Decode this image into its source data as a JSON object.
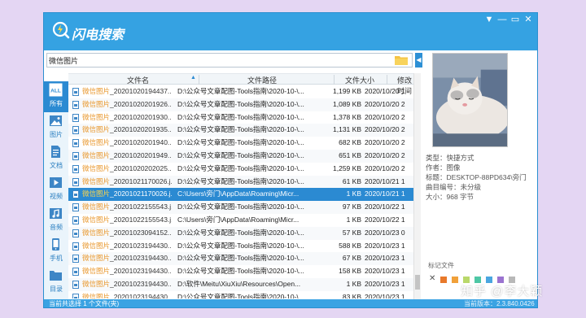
{
  "app": {
    "title": "闪电搜索",
    "window_buttons": [
      "▼",
      "—",
      "▭",
      "✕"
    ]
  },
  "search": {
    "value": "微信图片",
    "placeholder": ""
  },
  "sidebar": {
    "items": [
      {
        "label": "所有",
        "icon": "all-icon",
        "active": true
      },
      {
        "label": "图片",
        "icon": "image-icon"
      },
      {
        "label": "文档",
        "icon": "document-icon"
      },
      {
        "label": "视频",
        "icon": "video-icon"
      },
      {
        "label": "音频",
        "icon": "audio-icon"
      },
      {
        "label": "手机",
        "icon": "phone-icon"
      },
      {
        "label": "目录",
        "icon": "folder-icon"
      }
    ]
  },
  "table": {
    "columns": [
      "文件名",
      "文件路径",
      "文件大小",
      "修改时间"
    ],
    "rows": [
      {
        "hl": "微信图片",
        "name": "_20201020194437...",
        "path": "D:\\公众号文章配图-Tools指南\\2020-10-\\...",
        "size": "1,199 KB",
        "date": "2020/10/20 1"
      },
      {
        "hl": "微信图片",
        "name": "_20201020201926...",
        "path": "D:\\公众号文章配图-Tools指南\\2020-10-\\...",
        "size": "1,089 KB",
        "date": "2020/10/20 2"
      },
      {
        "hl": "微信图片",
        "name": "_20201020201930...",
        "path": "D:\\公众号文章配图-Tools指南\\2020-10-\\...",
        "size": "1,378 KB",
        "date": "2020/10/20 2"
      },
      {
        "hl": "微信图片",
        "name": "_20201020201935...",
        "path": "D:\\公众号文章配图-Tools指南\\2020-10-\\...",
        "size": "1,131 KB",
        "date": "2020/10/20 2"
      },
      {
        "hl": "微信图片",
        "name": "_20201020201940...",
        "path": "D:\\公众号文章配图-Tools指南\\2020-10-\\...",
        "size": "682 KB",
        "date": "2020/10/20 2"
      },
      {
        "hl": "微信图片",
        "name": "_20201020201949...",
        "path": "D:\\公众号文章配图-Tools指南\\2020-10-\\...",
        "size": "651 KB",
        "date": "2020/10/20 2"
      },
      {
        "hl": "微信图片",
        "name": "_20201020202025...",
        "path": "D:\\公众号文章配图-Tools指南\\2020-10-\\...",
        "size": "1,259 KB",
        "date": "2020/10/20 2"
      },
      {
        "hl": "微信图片",
        "name": "_20201021170026.j...",
        "path": "D:\\公众号文章配图-Tools指南\\2020-10-\\...",
        "size": "61 KB",
        "date": "2020/10/21 1"
      },
      {
        "hl": "微信图片",
        "name": "_20201021170026.j...",
        "path": "C:\\Users\\旁门\\AppData\\Roaming\\Micr...",
        "size": "1 KB",
        "date": "2020/10/21 1",
        "selected": true
      },
      {
        "hl": "微信图片",
        "name": "_20201022155543.j...",
        "path": "D:\\公众号文章配图-Tools指南\\2020-10-\\...",
        "size": "97 KB",
        "date": "2020/10/22 1"
      },
      {
        "hl": "微信图片",
        "name": "_20201022155543.j...",
        "path": "C:\\Users\\旁门\\AppData\\Roaming\\Micr...",
        "size": "1 KB",
        "date": "2020/10/22 1"
      },
      {
        "hl": "微信图片",
        "name": "_20201023094152...",
        "path": "D:\\公众号文章配图-Tools指南\\2020-10-\\...",
        "size": "57 KB",
        "date": "2020/10/23 0"
      },
      {
        "hl": "微信图片",
        "name": "_20201023194430...",
        "path": "D:\\公众号文章配图-Tools指南\\2020-10-\\...",
        "size": "588 KB",
        "date": "2020/10/23 1"
      },
      {
        "hl": "微信图片",
        "name": "_20201023194430...",
        "path": "D:\\公众号文章配图-Tools指南\\2020-10-\\...",
        "size": "67 KB",
        "date": "2020/10/23 1"
      },
      {
        "hl": "微信图片",
        "name": "_20201023194430...",
        "path": "D:\\公众号文章配图-Tools指南\\2020-10-\\...",
        "size": "158 KB",
        "date": "2020/10/23 1"
      },
      {
        "hl": "微信图片",
        "name": "_20201023194430...",
        "path": "D:\\软件\\Meitu\\XiuXiu\\Resources\\Open...",
        "size": "1 KB",
        "date": "2020/10/23 1"
      },
      {
        "hl": "微信图片",
        "name": "_20201023194430...",
        "path": "D:\\公众号文章配图-Tools指南\\2020-10-\\...",
        "size": "83 KB",
        "date": "2020/10/23 1"
      }
    ]
  },
  "preview": {
    "meta": [
      "类型：快捷方式",
      "作者：图像",
      "标题：DESKTOP-88PD634\\旁门",
      "曲目编号：未分级",
      "大小：968 字节"
    ],
    "tag_label": "标记文件",
    "tag_colors": [
      "#e8792b",
      "#f1a13a",
      "#b9d86a",
      "#4ec7a5",
      "#4aa6e0",
      "#9b73d0",
      "#b8b8b8"
    ]
  },
  "status": {
    "text": "当前共选择 1 个文件(夹)",
    "version": "当前版本：2.3.840.0426"
  },
  "watermark": "知乎 @李大颖",
  "colors": {
    "accent": "#35a2e2",
    "selection": "#2b8ad2",
    "highlight": "#e8962a",
    "page_bg": "#e4d6f3"
  }
}
